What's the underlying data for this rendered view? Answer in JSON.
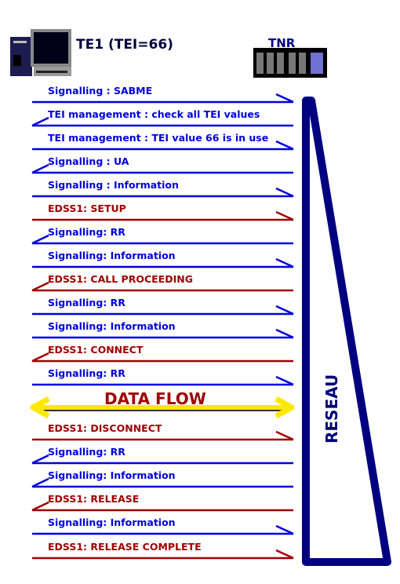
{
  "te_label": "TE1 (TEI=66)",
  "tnr_label": "TNR",
  "network_label": "RESEAU",
  "data_flow_label": "DATA FLOW",
  "colors": {
    "signalling": "#0000dd",
    "edss1": "#a00000",
    "network": "#000080",
    "data_flow_arrow": "#ffe800",
    "data_flow_text": "#a00000"
  },
  "messages": [
    {
      "text": "Signalling : SABME",
      "dir": "right",
      "type": "signalling"
    },
    {
      "text": "TEI management : check all TEI values",
      "dir": "left",
      "type": "signalling"
    },
    {
      "text": "TEI management : TEI value 66 is in use",
      "dir": "right",
      "type": "signalling"
    },
    {
      "text": "Signalling : UA",
      "dir": "left",
      "type": "signalling"
    },
    {
      "text": "Signalling : Information",
      "dir": "right",
      "type": "signalling"
    },
    {
      "text": "EDSS1: SETUP",
      "dir": "right",
      "type": "edss1"
    },
    {
      "text": "Signalling: RR",
      "dir": "left",
      "type": "signalling"
    },
    {
      "text": "Signalling: Information",
      "dir": "right",
      "type": "signalling"
    },
    {
      "text": "EDSS1: CALL PROCEEDING",
      "dir": "left",
      "type": "edss1"
    },
    {
      "text": "Signalling: RR",
      "dir": "right",
      "type": "signalling"
    },
    {
      "text": "Signalling: Information",
      "dir": "right",
      "type": "signalling"
    },
    {
      "text": "EDSS1: CONNECT",
      "dir": "left",
      "type": "edss1"
    },
    {
      "text": "Signalling: RR",
      "dir": "right",
      "type": "signalling"
    },
    {
      "text": "EDSS1: DISCONNECT",
      "dir": "right",
      "type": "edss1"
    },
    {
      "text": "Signalling: RR",
      "dir": "left",
      "type": "signalling"
    },
    {
      "text": "Signalling: Information",
      "dir": "left",
      "type": "signalling"
    },
    {
      "text": "EDSS1: RELEASE",
      "dir": "left",
      "type": "edss1"
    },
    {
      "text": "Signalling: Information",
      "dir": "right",
      "type": "signalling"
    },
    {
      "text": "EDSS1: RELEASE COMPLETE",
      "dir": "right",
      "type": "edss1"
    }
  ]
}
